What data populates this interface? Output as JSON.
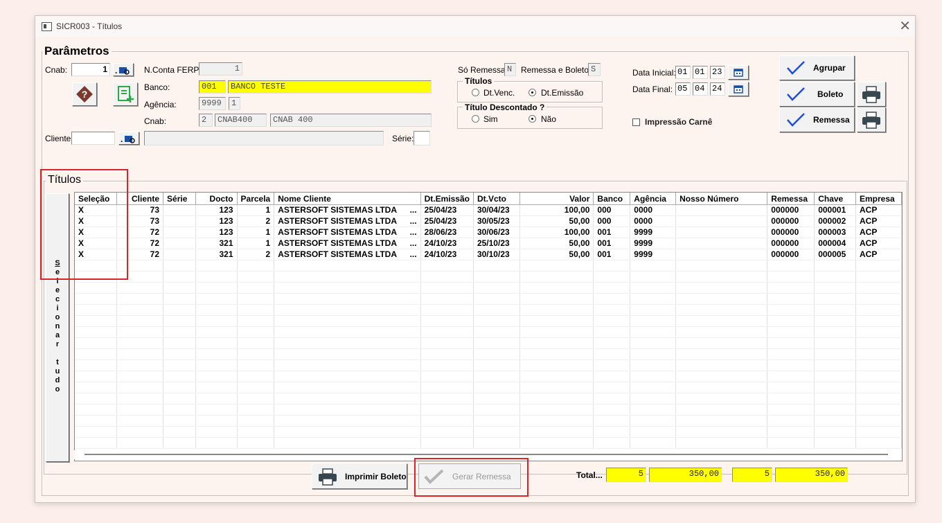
{
  "window": {
    "title": "SICR003 - Títulos"
  },
  "params": {
    "title": "Parâmetros",
    "cnab_label": "Cnab:",
    "cnab_value": "1",
    "nconta_label": "N.Conta FERP:",
    "nconta_value": "1",
    "banco_label": "Banco:",
    "banco_code": "001",
    "banco_name": "BANCO TESTE",
    "agencia_label": "Agência:",
    "agencia_code": "9999",
    "agencia_digit": "1",
    "cnab2_label": "Cnab:",
    "cnab2_num": "2",
    "cnab2_code": "CNAB400",
    "cnab2_desc": "CNAB 400",
    "cliente_label": "Cliente:",
    "cliente_value": "",
    "cliente_desc": "",
    "serie_label": "Série:",
    "serie_value": "",
    "so_remessa_label": "Só Remessa:",
    "so_remessa_value": "N",
    "remessa_boleto_label": "Remessa e Boleto:",
    "remessa_boleto_value": "S",
    "titulos_group": "Títulos",
    "dt_venc": "Dt.Venc.",
    "dt_emissao": "Dt.Emissão",
    "titulos_selected": "Dt.Emissão",
    "desc_group": "Título Descontado ?",
    "sim": "Sim",
    "nao": "Não",
    "desc_selected": "Não",
    "data_inicial_label": "Data Inicial:",
    "di_d": "01",
    "di_m": "01",
    "di_y": "23",
    "data_final_label": "Data Final:",
    "df_d": "05",
    "df_m": "04",
    "df_y": "24",
    "impressao_carne": "Impressão Carnê",
    "impressao_carne_checked": false
  },
  "actions": {
    "agrupar": "Agrupar",
    "boleto": "Boleto",
    "remessa": "Remessa"
  },
  "titulos": {
    "title": "Títulos",
    "select_all_letters": [
      "S",
      "e",
      "l",
      "e",
      "c",
      "i",
      "o",
      "n",
      "a",
      "r",
      " ",
      "t",
      "u",
      "d",
      "o"
    ],
    "columns": [
      "Seleção",
      "Cliente",
      "Série",
      "Docto",
      "Parcela",
      "Nome Cliente",
      "Dt.Emissão",
      "Dt.Vcto",
      "Valor",
      "Banco",
      "Agência",
      "Nosso Número",
      "Remessa",
      "Chave",
      "Empresa"
    ],
    "rows": [
      [
        "X",
        "73",
        "",
        "123",
        "1",
        "ASTERSOFT SISTEMAS LTDA",
        "25/04/23",
        "30/04/23",
        "100,00",
        "000",
        "0000",
        "",
        "000000",
        "000001",
        "ACP"
      ],
      [
        "X",
        "73",
        "",
        "123",
        "2",
        "ASTERSOFT SISTEMAS LTDA",
        "25/04/23",
        "30/05/23",
        "50,00",
        "000",
        "0000",
        "",
        "000000",
        "000002",
        "ACP"
      ],
      [
        "X",
        "72",
        "",
        "123",
        "1",
        "ASTERSOFT SISTEMAS LTDA",
        "28/06/23",
        "30/06/23",
        "100,00",
        "001",
        "9999",
        "",
        "000000",
        "000003",
        "ACP"
      ],
      [
        "X",
        "72",
        "",
        "321",
        "1",
        "ASTERSOFT SISTEMAS LTDA",
        "24/10/23",
        "25/10/23",
        "50,00",
        "001",
        "9999",
        "",
        "000000",
        "000004",
        "ACP"
      ],
      [
        "X",
        "72",
        "",
        "321",
        "2",
        "ASTERSOFT SISTEMAS LTDA",
        "24/10/23",
        "30/10/23",
        "50,00",
        "001",
        "9999",
        "",
        "000000",
        "000005",
        "ACP"
      ]
    ],
    "ellipsis": "..."
  },
  "footer": {
    "imprimir_boleto": "Imprimir Boleto",
    "gerar_remessa": "Gerar Remessa",
    "total_label": "Total...",
    "count1": "5",
    "value1": "350,00",
    "count2": "5",
    "value2": "350,00"
  },
  "colors": {
    "highlight_red": "#d6262b",
    "field_yellow": "#ffff00",
    "check_blue": "#1e4fd8",
    "help_brown": "#7a3b2e",
    "add_green": "#2aa84a"
  }
}
